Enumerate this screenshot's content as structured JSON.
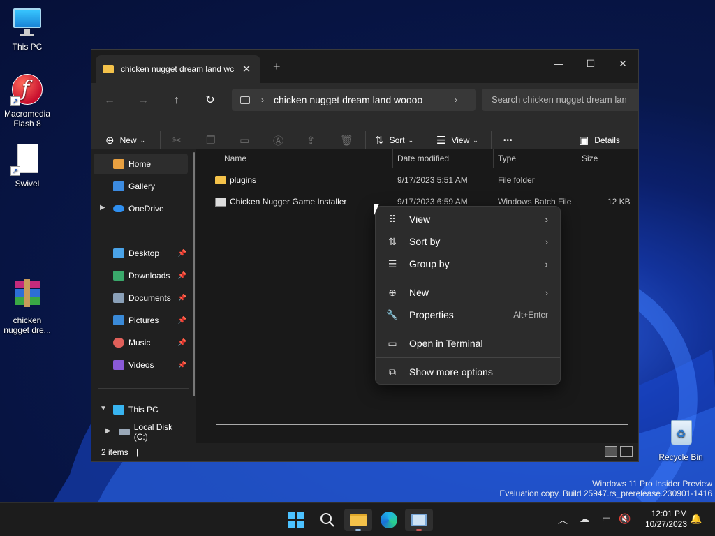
{
  "desktop": {
    "icons": [
      {
        "label_line1": "This PC",
        "label_line2": ""
      },
      {
        "label_line1": "Macromedia",
        "label_line2": "Flash 8"
      },
      {
        "label_line1": "Swivel",
        "label_line2": ""
      },
      {
        "label_line1": "chicken",
        "label_line2": "nugget dre..."
      },
      {
        "label_line1": "Recycle Bin",
        "label_line2": ""
      }
    ],
    "watermark_line1": "Windows 11 Pro Insider Preview",
    "watermark_line2": "Evaluation copy. Build 25947.rs_prerelease.230901-1416"
  },
  "window": {
    "tab_title": "chicken nugget dream land wc",
    "tab_close": "✕",
    "new_tab": "+",
    "minimize": "—",
    "maximize": "☐",
    "close": "✕",
    "nav": {
      "back": "←",
      "forward": "→",
      "up": "↑",
      "refresh": "↻"
    },
    "address": {
      "chevron1": "›",
      "path": "chicken nugget dream land woooo",
      "chevron2": "›"
    },
    "search_placeholder": "Search chicken nugget dream lan"
  },
  "toolbar": {
    "new_label": "New",
    "sort_label": "Sort",
    "view_label": "View",
    "more": "•••",
    "details_label": "Details"
  },
  "sidebar": {
    "home": "Home",
    "gallery": "Gallery",
    "onedrive": "OneDrive",
    "desktop": "Desktop",
    "downloads": "Downloads",
    "documents": "Documents",
    "pictures": "Pictures",
    "music": "Music",
    "videos": "Videos",
    "this_pc": "This PC",
    "local_disk": "Local Disk (C:)"
  },
  "columns": {
    "name": "Name",
    "date": "Date modified",
    "type": "Type",
    "size": "Size"
  },
  "files": [
    {
      "name": "plugins",
      "date": "9/17/2023 5:51 AM",
      "type": "File folder",
      "size": ""
    },
    {
      "name": "Chicken Nugger Game Installer",
      "date": "9/17/2023 6:59 AM",
      "type": "Windows Batch File",
      "size": "12 KB"
    }
  ],
  "status": {
    "items": "2 items",
    "divider": "|"
  },
  "context_menu": {
    "view": "View",
    "sort_by": "Sort by",
    "group_by": "Group by",
    "new": "New",
    "properties": "Properties",
    "properties_accel": "Alt+Enter",
    "open_terminal": "Open in Terminal",
    "show_more": "Show more options"
  },
  "taskbar": {
    "time": "12:01 PM",
    "date": "10/27/2023"
  },
  "colors": {
    "accent": "#0078d4",
    "folder": "#f4c24a"
  }
}
